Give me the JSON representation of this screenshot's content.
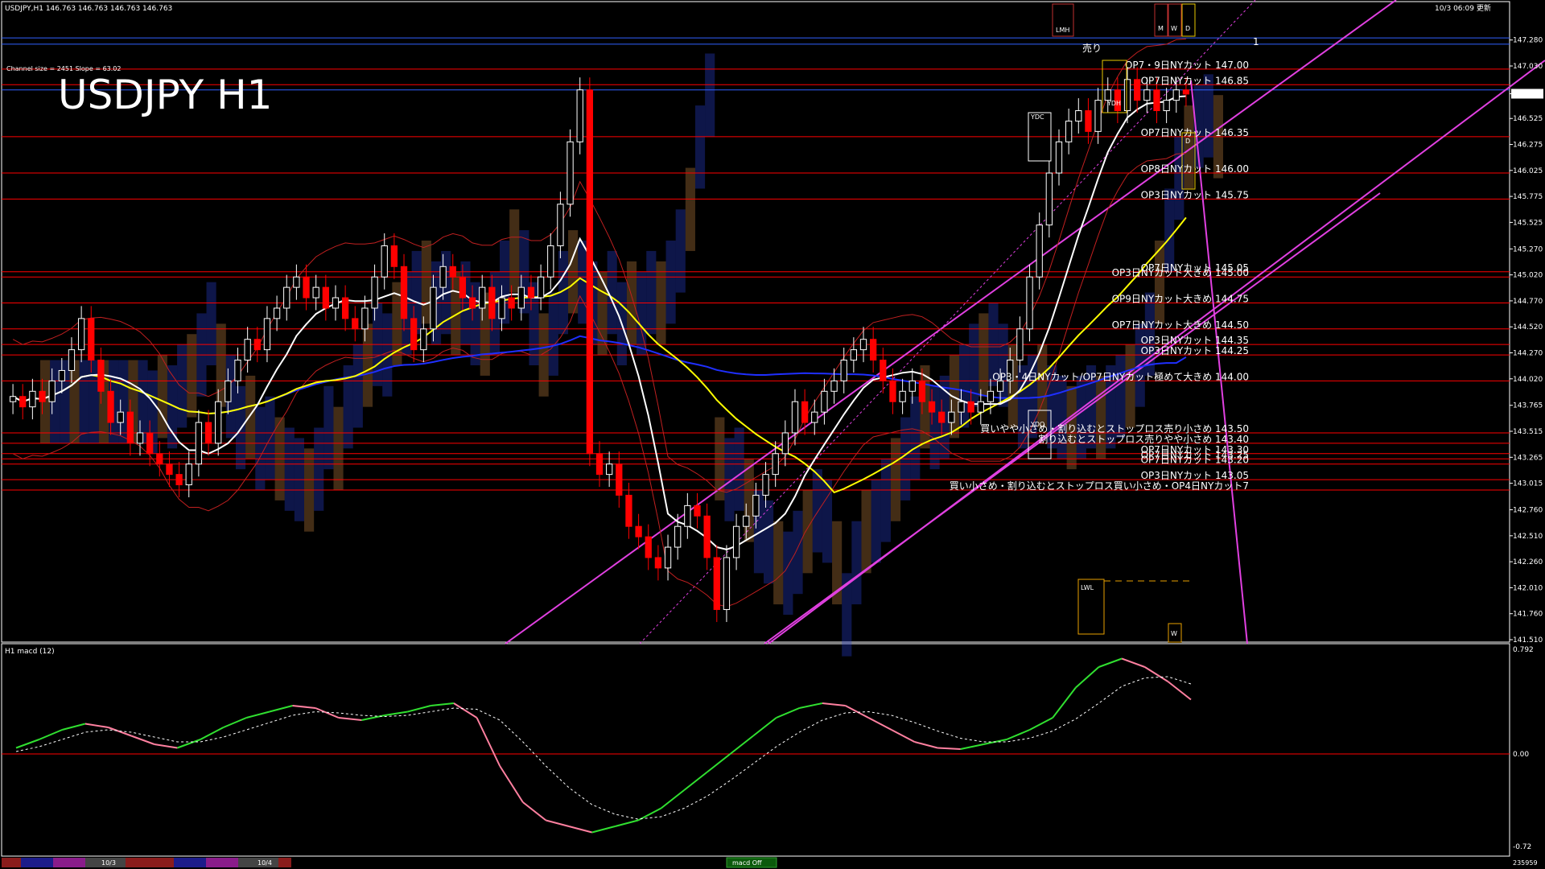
{
  "header": {
    "info": "USDJPY,H1  146.763 146.763 146.763 146.763",
    "datetime": "10/3 06:09 更新",
    "channel": "Channel size = 2451 Slope = 63.02",
    "title": "USDJPY H1"
  },
  "macd_panel": {
    "label": "H1 macd (12)",
    "ymax": "0.792",
    "yzero": "0.00",
    "ymin": "-0.72",
    "counter": "235959"
  },
  "bottom_bar": {
    "d1": "10/3",
    "d2": "10/4",
    "macd_off": "macd Off"
  },
  "colors": {
    "bull": "#ffffff",
    "bear": "#ff0000",
    "level_red": "#ff0000",
    "channel": "#e040e0",
    "sma_white": "#ffffff",
    "sma_yellow": "#ffff00",
    "sma_blue": "#1f2fff",
    "cloud_blue": "#2840d0",
    "cloud_orange": "#c08040",
    "macd_up": "#30e030",
    "macd_down": "#ff80a0",
    "price_tag": "#ffffff"
  },
  "chart_data": {
    "type": "candlestick",
    "symbol": "USDJPY",
    "timeframe": "H1",
    "ylim": [
      141.51,
      147.51
    ],
    "current_price": 146.763,
    "y_ticks": [
      "147.280",
      "147.030",
      "146.763",
      "146.525",
      "146.275",
      "146.025",
      "145.775",
      "145.525",
      "145.270",
      "145.020",
      "144.770",
      "144.520",
      "144.270",
      "144.020",
      "143.765",
      "143.515",
      "143.265",
      "143.015",
      "142.760",
      "142.510",
      "142.260",
      "142.010",
      "141.760",
      "141.510"
    ],
    "levels": [
      {
        "price": 147.0,
        "text": "OP7・9日NYカット 147.00"
      },
      {
        "price": 146.85,
        "text": "OP7日NYカット 146.85"
      },
      {
        "price": 146.35,
        "text": "OP7日NYカット 146.35"
      },
      {
        "price": 146.0,
        "text": "OP8日NYカット 146.00"
      },
      {
        "price": 145.75,
        "text": "OP3日NYカット 145.75"
      },
      {
        "price": 145.05,
        "text": "OP7日NYカット 145.05"
      },
      {
        "price": 145.0,
        "text": "OP3日NYカット大きめ 145.00"
      },
      {
        "price": 144.75,
        "text": "OP9日NYカット大きめ 144.75"
      },
      {
        "price": 144.5,
        "text": "OP7日NYカット大きめ 144.50"
      },
      {
        "price": 144.35,
        "text": "OP3日NYカット 144.35"
      },
      {
        "price": 144.25,
        "text": "OP3日NYカット 144.25"
      },
      {
        "price": 144.0,
        "text": "OP3・4日NYカット/OP7日NYカット極めて大きめ 144.00"
      },
      {
        "price": 143.5,
        "text": "買いやや小さめ・割り込むとストップロス売り小さめ 143.50"
      },
      {
        "price": 143.4,
        "text": "割り込むとストップロス売りやや小さめ 143.40"
      },
      {
        "price": 143.3,
        "text": "OP7日NYカット 143.30"
      },
      {
        "price": 143.25,
        "text": "OP7日NYカット 143.25"
      },
      {
        "price": 143.2,
        "text": "OP7日NYカット 143.20"
      },
      {
        "price": 143.05,
        "text": "OP3日NYカット 143.05"
      },
      {
        "price": 142.95,
        "text": "買い小さめ・割り込むとストップロス買い小さめ・OP4日NYカット7"
      }
    ],
    "markers": [
      "売り",
      "LMH",
      "M",
      "W",
      "D",
      "YDC",
      "YDH",
      "YDO",
      "LWL",
      "W",
      "D",
      "1"
    ],
    "candles": [
      143.85,
      143.75,
      143.9,
      143.8,
      144.0,
      144.1,
      144.3,
      144.6,
      144.2,
      143.9,
      143.6,
      143.7,
      143.4,
      143.5,
      143.3,
      143.2,
      143.1,
      143.0,
      143.2,
      143.6,
      143.4,
      143.8,
      144.0,
      144.2,
      144.4,
      144.3,
      144.6,
      144.7,
      144.9,
      145.0,
      144.8,
      144.9,
      144.7,
      144.8,
      144.6,
      144.5,
      144.7,
      145.0,
      145.3,
      145.1,
      144.6,
      144.3,
      144.5,
      144.9,
      145.1,
      145.0,
      144.8,
      144.7,
      144.9,
      144.6,
      144.8,
      144.7,
      144.9,
      144.8,
      145.0,
      145.3,
      145.7,
      146.3,
      146.8,
      143.3,
      143.1,
      143.2,
      142.9,
      142.6,
      142.5,
      142.3,
      142.2,
      142.4,
      142.6,
      142.8,
      142.7,
      142.3,
      141.8,
      142.3,
      142.6,
      142.7,
      142.9,
      143.1,
      143.3,
      143.5,
      143.8,
      143.6,
      143.7,
      143.9,
      144.0,
      144.2,
      144.3,
      144.4,
      144.2,
      144.0,
      143.8,
      143.9,
      144.0,
      143.8,
      143.7,
      143.6,
      143.7,
      143.8,
      143.7,
      143.8,
      143.9,
      144.0,
      144.2,
      144.5,
      145.0,
      145.5,
      146.0,
      146.3,
      146.5,
      146.6,
      146.4,
      146.7,
      146.8,
      146.6,
      146.9,
      146.7,
      146.8,
      146.6,
      146.7,
      146.8,
      146.76
    ],
    "macd": [
      0.05,
      0.12,
      0.2,
      0.25,
      0.22,
      0.15,
      0.08,
      0.05,
      0.12,
      0.22,
      0.3,
      0.35,
      0.4,
      0.38,
      0.3,
      0.28,
      0.32,
      0.35,
      0.4,
      0.42,
      0.3,
      -0.1,
      -0.4,
      -0.55,
      -0.6,
      -0.65,
      -0.6,
      -0.55,
      -0.45,
      -0.3,
      -0.15,
      0.0,
      0.15,
      0.3,
      0.38,
      0.42,
      0.4,
      0.3,
      0.2,
      0.1,
      0.05,
      0.04,
      0.08,
      0.12,
      0.2,
      0.3,
      0.55,
      0.72,
      0.79,
      0.72,
      0.6,
      0.45
    ],
    "signal": [
      0.02,
      0.06,
      0.12,
      0.18,
      0.2,
      0.18,
      0.14,
      0.1,
      0.1,
      0.14,
      0.2,
      0.26,
      0.32,
      0.35,
      0.34,
      0.32,
      0.31,
      0.32,
      0.35,
      0.38,
      0.37,
      0.28,
      0.1,
      -0.1,
      -0.28,
      -0.42,
      -0.5,
      -0.54,
      -0.52,
      -0.45,
      -0.35,
      -0.22,
      -0.08,
      0.06,
      0.18,
      0.28,
      0.34,
      0.35,
      0.32,
      0.26,
      0.19,
      0.13,
      0.1,
      0.1,
      0.13,
      0.19,
      0.29,
      0.42,
      0.56,
      0.63,
      0.64,
      0.58
    ]
  }
}
